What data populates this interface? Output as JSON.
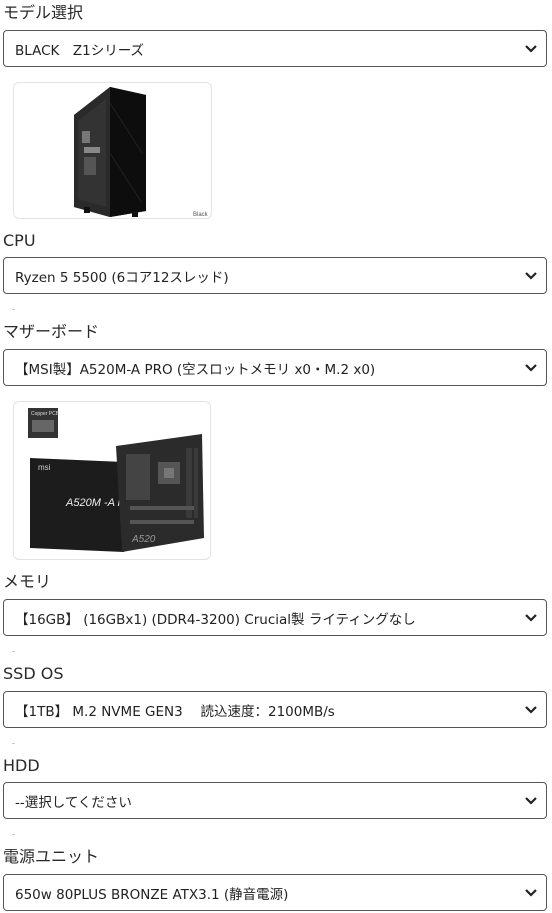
{
  "sections": [
    {
      "label": "モデル選択",
      "value": "BLACK　Z1シリーズ"
    },
    {
      "label": "CPU",
      "value": "Ryzen 5 5500 (6コア12スレッド)"
    },
    {
      "label": "マザーボード",
      "value": "【MSI製】A520M-A PRO (空スロットメモリ x0・M.2 x0)"
    },
    {
      "label": "メモリ",
      "value": "【16GB】 (16GBx1) (DDR4-3200) Crucial製 ライティングなし"
    },
    {
      "label": "SSD OS",
      "value": "【1TB】 M.2 NVME GEN3　 読込速度：2100MB/s"
    },
    {
      "label": "HDD",
      "value": "--選択してください"
    },
    {
      "label": "電源ユニット",
      "value": "650w 80PLUS BRONZE ATX3.1 (静音電源)"
    }
  ],
  "case_image": {
    "caption": "Black"
  },
  "mobo_image": {
    "badge": "Copper PCB",
    "model_text": "A520M -A PRO",
    "brand": "msi",
    "model_short": "A520"
  },
  "colors": {
    "border": "#555555",
    "text": "#222222",
    "chevron": "#222222"
  }
}
